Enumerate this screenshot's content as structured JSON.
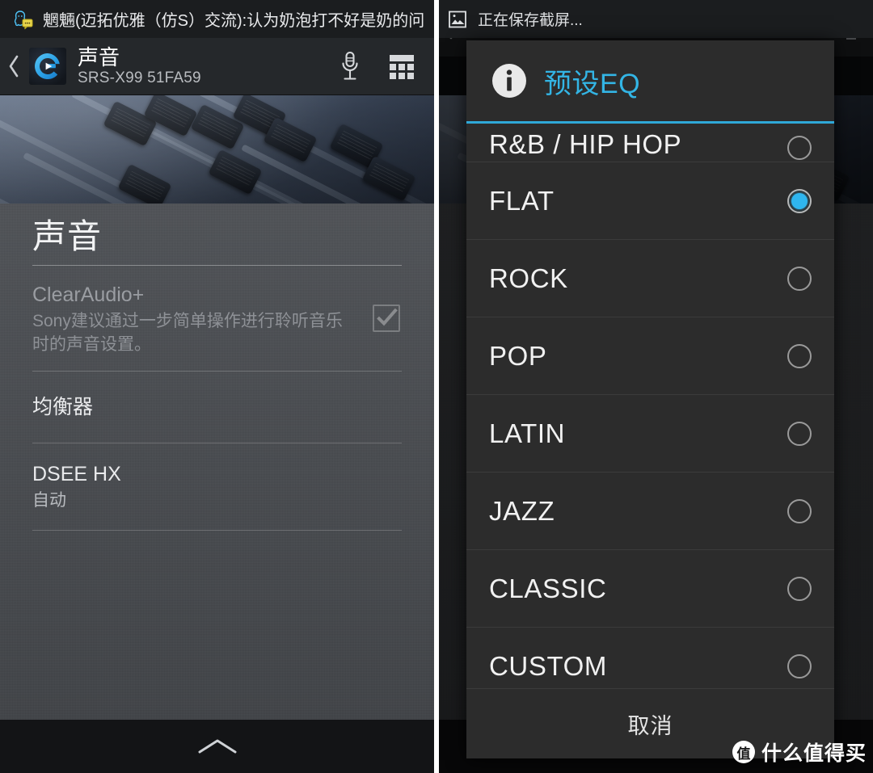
{
  "left_phone": {
    "status_bar": {
      "notification_icon": "qq-message-icon",
      "notification_text": "魍魎(迈拓优雅（仿S）交流):认为奶泡打不好是奶的问"
    },
    "action_bar": {
      "back_icon": "back-chevron-icon",
      "app_icon": "sony-music-center-icon",
      "title": "声音",
      "subtitle": "SRS-X99 51FA59",
      "mic_icon": "microphone-icon",
      "grid_icon": "grid-dashboard-icon"
    },
    "page": {
      "heading": "声音",
      "rows": [
        {
          "title": "ClearAudio+",
          "subtitle": "Sony建议通过一步简单操作进行聆听音乐时的声音设置。",
          "checkbox": "checked",
          "enabled": "disabled"
        },
        {
          "title": "均衡器",
          "subtitle": ""
        },
        {
          "title": "DSEE HX",
          "subtitle": "自动"
        }
      ]
    },
    "bottom_handle_icon": "chevron-up-icon"
  },
  "right_phone": {
    "status_bar": {
      "notification_icon": "screenshot-image-icon",
      "notification_text": "正在保存截屏..."
    },
    "action_bar": {
      "back_icon": "back-chevron-icon",
      "overflow_icon": "overflow-grid-icon"
    },
    "dialog": {
      "info_icon": "info-circle-icon",
      "title": "预设EQ",
      "accent_color": "#2fa8d8",
      "title_color": "#33b5e5",
      "selected_value": "FLAT",
      "options": [
        {
          "label": "R&B / HIP HOP",
          "selected": false
        },
        {
          "label": "FLAT",
          "selected": true
        },
        {
          "label": "ROCK",
          "selected": false
        },
        {
          "label": "POP",
          "selected": false
        },
        {
          "label": "LATIN",
          "selected": false
        },
        {
          "label": "JAZZ",
          "selected": false
        },
        {
          "label": "CLASSIC",
          "selected": false
        },
        {
          "label": "CUSTOM",
          "selected": false
        }
      ],
      "cancel_label": "取消"
    }
  },
  "watermark": {
    "badge": "值",
    "text": "什么值得买"
  }
}
